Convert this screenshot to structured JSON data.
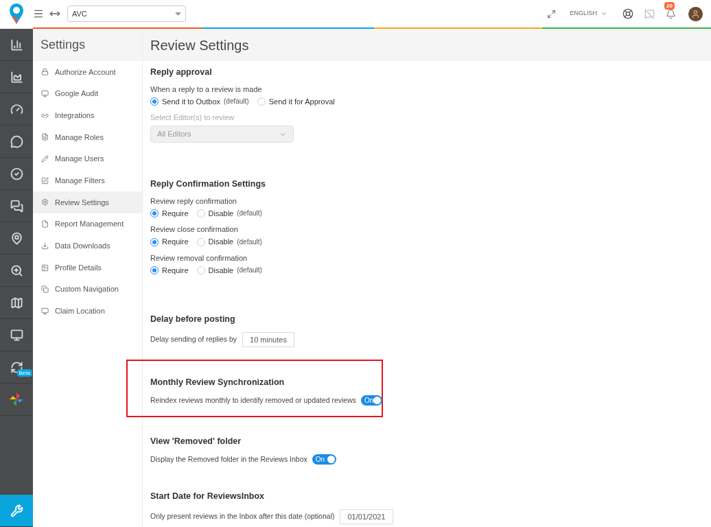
{
  "topbar": {
    "location_select": {
      "value": "AVC"
    },
    "language": "ENGLISH",
    "notification_count": "20"
  },
  "rail": [
    {
      "selected": false
    },
    {
      "selected": false
    },
    {
      "selected": false
    },
    {
      "selected": false
    },
    {
      "selected": false
    },
    {
      "selected": false
    },
    {
      "selected": false
    },
    {
      "selected": false
    },
    {
      "selected": false
    },
    {
      "selected": false
    },
    {
      "selected": false,
      "badge": "Beta"
    },
    {
      "selected": false
    }
  ],
  "rail_bottom": {
    "selected": true
  },
  "sidebar": {
    "title": "Settings",
    "items": [
      {
        "label": "Authorize Account",
        "selected": false
      },
      {
        "label": "Google Audit",
        "selected": false
      },
      {
        "label": "Integrations",
        "selected": false
      },
      {
        "label": "Manage Roles",
        "selected": false
      },
      {
        "label": "Manage Users",
        "selected": false
      },
      {
        "label": "Manage Filters",
        "selected": false
      },
      {
        "label": "Review Settings",
        "selected": true
      },
      {
        "label": "Report Management",
        "selected": false
      },
      {
        "label": "Data Downloads",
        "selected": false
      },
      {
        "label": "Profile Details",
        "selected": false
      },
      {
        "label": "Custom Navigation",
        "selected": false
      },
      {
        "label": "Claim Location",
        "selected": false
      }
    ]
  },
  "page_title": "Review Settings",
  "sections": [
    {
      "title": "Reply approval",
      "highlighted": false,
      "rows": [
        {
          "kind": "radio",
          "label": "When a reply to a review is made",
          "options": [
            {
              "label": "Send it to Outbox",
              "note": "(default)",
              "selected": true
            },
            {
              "label": "Send it for Approval",
              "selected": false
            }
          ]
        },
        {
          "kind": "dropdown",
          "label": "Select Editor(s) to review",
          "value": "All Editors",
          "disabled": true
        }
      ]
    },
    {
      "title": "Reply Confirmation Settings",
      "highlighted": false,
      "rows": [
        {
          "kind": "radio",
          "label": "Review reply confirmation",
          "options": [
            {
              "label": "Require",
              "selected": true
            },
            {
              "label": "Disable",
              "note": "(default)",
              "selected": false
            }
          ]
        },
        {
          "kind": "radio",
          "label": "Review close confirmation",
          "options": [
            {
              "label": "Require",
              "selected": true
            },
            {
              "label": "Disable",
              "note": "(default)",
              "selected": false
            }
          ]
        },
        {
          "kind": "radio",
          "label": "Review removal confirmation",
          "options": [
            {
              "label": "Require",
              "selected": true
            },
            {
              "label": "Disable",
              "note": "(default)",
              "selected": false
            }
          ]
        }
      ]
    },
    {
      "title": "Delay before posting",
      "highlighted": false,
      "rows": [
        {
          "kind": "input",
          "label": "Delay sending of replies by",
          "value": "10 minutes"
        }
      ]
    },
    {
      "title": "Monthly Review Synchronization",
      "highlighted": true,
      "rows": [
        {
          "kind": "toggle",
          "label": "Reindex reviews monthly to identify removed or updated reviews",
          "on": true,
          "state_label": "On"
        }
      ]
    },
    {
      "title": "View 'Removed' folder",
      "highlighted": false,
      "rows": [
        {
          "kind": "toggle",
          "label": "Display the Removed folder in the Reviews Inbox",
          "on": true,
          "state_label": "On"
        }
      ]
    },
    {
      "title": "Start Date for ReviewsInbox",
      "highlighted": false,
      "rows": [
        {
          "kind": "input",
          "label": "Only present reviews in the Inbox after this date (optional)",
          "value": "01/01/2021"
        }
      ]
    }
  ]
}
